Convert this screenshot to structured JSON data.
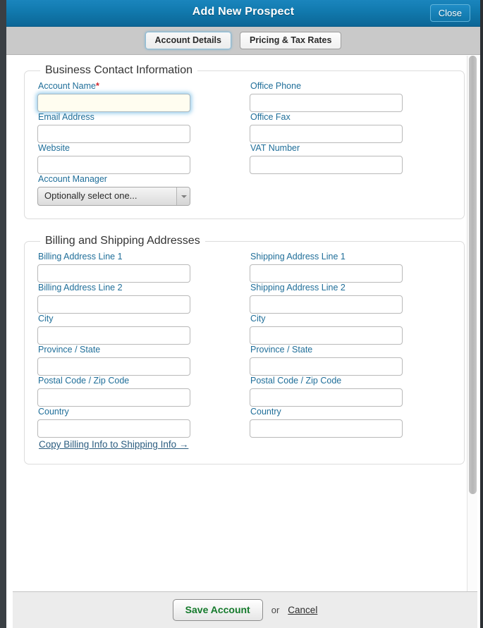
{
  "titlebar": {
    "title": "Add New Prospect",
    "close_label": "Close",
    "accent_color": "#0c6696"
  },
  "tabs": [
    {
      "label": "Account Details",
      "active": true
    },
    {
      "label": "Pricing & Tax Rates",
      "active": false
    }
  ],
  "sections": [
    {
      "legend": "Business Contact Information",
      "rows": [
        {
          "left": {
            "label": "Account Name",
            "required": true,
            "required_mark": "*",
            "type": "text",
            "value": "",
            "focused": true
          },
          "right": {
            "label": "Office Phone",
            "required": false,
            "type": "text",
            "value": "",
            "focused": false
          }
        },
        {
          "left": {
            "label": "Email Address",
            "required": false,
            "type": "text",
            "value": "",
            "focused": false
          },
          "right": {
            "label": "Office Fax",
            "required": false,
            "type": "text",
            "value": "",
            "focused": false
          }
        },
        {
          "left": {
            "label": "Website",
            "required": false,
            "type": "text",
            "value": "",
            "focused": false
          },
          "right": {
            "label": "VAT Number",
            "required": false,
            "type": "text",
            "value": "",
            "focused": false
          }
        },
        {
          "left": {
            "label": "Account Manager",
            "required": false,
            "type": "select",
            "value": "Optionally select one...",
            "focused": false
          },
          "right": null
        }
      ]
    },
    {
      "legend": "Billing and Shipping Addresses",
      "rows": [
        {
          "left": {
            "label": "Billing Address Line 1",
            "required": false,
            "type": "text",
            "value": "",
            "focused": false
          },
          "right": {
            "label": "Shipping Address Line 1",
            "required": false,
            "type": "text",
            "value": "",
            "focused": false
          }
        },
        {
          "left": {
            "label": "Billing Address Line 2",
            "required": false,
            "type": "text",
            "value": "",
            "focused": false
          },
          "right": {
            "label": "Shipping Address Line 2",
            "required": false,
            "type": "text",
            "value": "",
            "focused": false
          }
        },
        {
          "left": {
            "label": "City",
            "required": false,
            "type": "text",
            "value": "",
            "focused": false
          },
          "right": {
            "label": "City",
            "required": false,
            "type": "text",
            "value": "",
            "focused": false
          }
        },
        {
          "left": {
            "label": "Province / State",
            "required": false,
            "type": "text",
            "value": "",
            "focused": false
          },
          "right": {
            "label": "Province / State",
            "required": false,
            "type": "text",
            "value": "",
            "focused": false
          }
        },
        {
          "left": {
            "label": "Postal Code / Zip Code",
            "required": false,
            "type": "text",
            "value": "",
            "focused": false
          },
          "right": {
            "label": "Postal Code / Zip Code",
            "required": false,
            "type": "text",
            "value": "",
            "focused": false
          }
        },
        {
          "left": {
            "label": "Country",
            "required": false,
            "type": "text",
            "value": "",
            "focused": false
          },
          "right": {
            "label": "Country",
            "required": false,
            "type": "text",
            "value": "",
            "focused": false
          }
        }
      ],
      "copy_link": "Copy Billing Info to Shipping Info →"
    }
  ],
  "footer": {
    "save_label": "Save Account",
    "or_label": "or",
    "cancel_label": "Cancel",
    "save_color": "#147a2b"
  }
}
